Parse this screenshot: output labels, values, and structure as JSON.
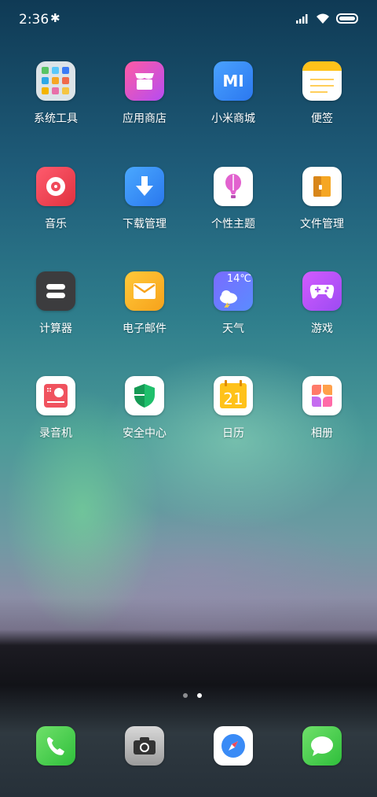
{
  "status": {
    "time": "2:36"
  },
  "apps": [
    {
      "label": "系统工具",
      "icon": "folder-icon"
    },
    {
      "label": "应用商店",
      "icon": "store-icon"
    },
    {
      "label": "小米商城",
      "icon": "mi-icon"
    },
    {
      "label": "便签",
      "icon": "notes-icon"
    },
    {
      "label": "音乐",
      "icon": "music-icon"
    },
    {
      "label": "下载管理",
      "icon": "download-icon"
    },
    {
      "label": "个性主题",
      "icon": "theme-icon"
    },
    {
      "label": "文件管理",
      "icon": "file-manager-icon"
    },
    {
      "label": "计算器",
      "icon": "calculator-icon"
    },
    {
      "label": "电子邮件",
      "icon": "mail-icon"
    },
    {
      "label": "天气",
      "icon": "weather-icon"
    },
    {
      "label": "游戏",
      "icon": "game-icon"
    },
    {
      "label": "录音机",
      "icon": "recorder-icon"
    },
    {
      "label": "安全中心",
      "icon": "security-icon"
    },
    {
      "label": "日历",
      "icon": "calendar-icon"
    },
    {
      "label": "相册",
      "icon": "gallery-icon"
    }
  ],
  "weather": {
    "temp": "14℃"
  },
  "calendar": {
    "day": "21"
  },
  "mi_logo": "MI",
  "dock": [
    {
      "icon": "phone-icon"
    },
    {
      "icon": "camera-icon"
    },
    {
      "icon": "browser-icon"
    },
    {
      "icon": "messages-icon"
    }
  ],
  "page_indicator": {
    "pages": 2,
    "current": 2
  }
}
